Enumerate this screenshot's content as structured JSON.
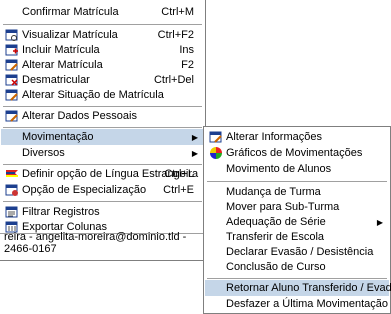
{
  "main_menu": {
    "items": [
      {
        "label": "Confirmar Matrícula",
        "shortcut": "Ctrl+M"
      },
      {
        "label": "Visualizar Matrícula",
        "shortcut": "Ctrl+F2",
        "icon": "view-icon"
      },
      {
        "label": "Incluir Matrícula",
        "shortcut": "Ins",
        "icon": "add-icon"
      },
      {
        "label": "Alterar Matrícula",
        "shortcut": "F2",
        "icon": "edit-icon"
      },
      {
        "label": "Desmatricular",
        "shortcut": "Ctrl+Del",
        "icon": "delete-icon"
      },
      {
        "label": "Alterar Situação de Matrícula",
        "icon": "edit-status-icon"
      },
      {
        "label": "Alterar Dados Pessoais",
        "icon": "edit-personal-icon"
      },
      {
        "label": "Movimentação"
      },
      {
        "label": "Diversos"
      },
      {
        "label": "Definir opção de Língua Estrangeira",
        "shortcut": "Ctrl+L",
        "icon": "flag-icon"
      },
      {
        "label": "Opção de Especialização",
        "shortcut": "Ctrl+E",
        "icon": "specialization-icon"
      },
      {
        "label": "Filtrar Registros",
        "icon": "filter-icon"
      },
      {
        "label": "Exportar Colunas",
        "icon": "export-icon"
      }
    ],
    "status_text": "reira - angelita-moreira@dominio.tld - 2466-0167"
  },
  "sub_menu": {
    "items": [
      {
        "label": "Alterar Informações",
        "icon": "edit-info-icon"
      },
      {
        "label": "Gráficos de Movimentações",
        "icon": "pie-chart-icon"
      },
      {
        "label": "Movimento de Alunos"
      },
      {
        "label": "Mudança de Turma"
      },
      {
        "label": "Mover para Sub-Turma"
      },
      {
        "label": "Adequação de Série"
      },
      {
        "label": "Transferir de Escola"
      },
      {
        "label": "Declarar Evasão / Desistência"
      },
      {
        "label": "Conclusão de Curso"
      },
      {
        "label": "Retornar Aluno Transferido / Evadido"
      },
      {
        "label": "Desfazer a Última Movimentação"
      }
    ]
  },
  "colors": {
    "highlight": "#c5d6e8",
    "border": "#7f7f7f"
  }
}
